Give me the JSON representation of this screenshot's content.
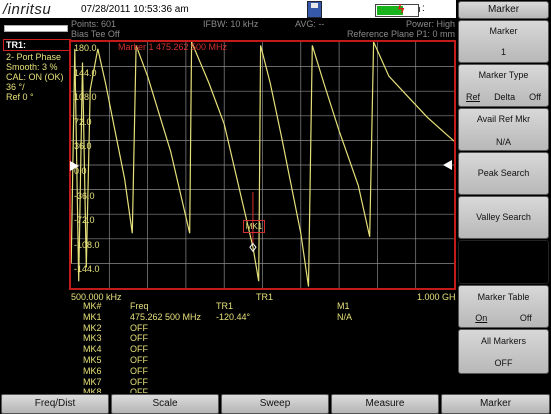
{
  "header": {
    "logo": "/inritsu",
    "datetime": "07/28/2011 10:53:36 am",
    "colon": ":"
  },
  "status": {
    "points": "Points: 601",
    "bias_tee": "Bias Tee Off",
    "ifbw": "IFBW: 10 kHz",
    "avg": "AVG: --",
    "power": "Power: High",
    "ref_plane": "Reference Plane P1: 0 mm",
    "battery_level": 0.65
  },
  "trace": {
    "name": "TR1:",
    "mode": "2- Port Phase",
    "smooth": "Smooth: 3 %",
    "cal": "CAL: ON (OK)",
    "scale": "36 °/",
    "ref": "Ref 0 °"
  },
  "plot": {
    "marker_readout": "Marker 1 475.262 500 MHz",
    "mk1_tag": "MK1",
    "y_ticks": [
      "180.0",
      "144.0",
      "108.0",
      "72.0",
      "36.0",
      "0.0",
      "-36.0",
      "-72.0",
      "-108.0",
      "-144.0"
    ],
    "x_start": "500.000 kHz",
    "x_trace": "TR1",
    "x_stop": "1.000 GHz",
    "trace_color": "#e6e07a",
    "grid_color": "#8a8a8a",
    "frame_color": "#c31a1a"
  },
  "chart_data": {
    "type": "line",
    "xlabel": "",
    "ylabel": "",
    "x_range": [
      "500.000 kHz",
      "1.000 GHz"
    ],
    "ylim": [
      -180,
      180
    ],
    "grid": true,
    "series": [
      {
        "name": "TR1",
        "x": [
          0.0005,
          0.01,
          0.02,
          0.03,
          0.04,
          0.05,
          0.07,
          0.09,
          0.115,
          0.14,
          0.16,
          0.17,
          0.2,
          0.26,
          0.31,
          0.315,
          0.36,
          0.4,
          0.45,
          0.475,
          0.49,
          0.495,
          0.52,
          0.55,
          0.6,
          0.62,
          0.63,
          0.66,
          0.7,
          0.75,
          0.78,
          0.79,
          0.83,
          0.88,
          0.93,
          0.98,
          1.0
        ],
        "y": [
          -144,
          170,
          -170,
          150,
          -150,
          110,
          170,
          120,
          50,
          -20,
          -100,
          175,
          130,
          20,
          -100,
          180,
          120,
          60,
          -60,
          -120,
          -170,
          175,
          120,
          40,
          -100,
          -178,
          175,
          120,
          50,
          -30,
          -105,
          180,
          130,
          100,
          70,
          45,
          35
        ]
      }
    ]
  },
  "markers_table": {
    "headers": [
      "MK#",
      "Freq",
      "TR1",
      "M1"
    ],
    "rows": [
      [
        "MK1",
        "475.262 500 MHz",
        "-120.44°",
        "N/A"
      ],
      [
        "MK2",
        "OFF",
        "",
        ""
      ],
      [
        "MK3",
        "OFF",
        "",
        ""
      ],
      [
        "MK4",
        "OFF",
        "",
        ""
      ],
      [
        "MK5",
        "OFF",
        "",
        ""
      ],
      [
        "MK6",
        "OFF",
        "",
        ""
      ],
      [
        "MK7",
        "OFF",
        "",
        ""
      ],
      [
        "MK8",
        "OFF",
        "",
        ""
      ]
    ]
  },
  "menu": {
    "title": "Marker",
    "marker_label": "Marker",
    "marker_value": "1",
    "marker_type_label": "Marker Type",
    "marker_type_ref": "Ref",
    "marker_type_delta": "Delta",
    "marker_type_off": "Off",
    "avail_ref_label": "Avail Ref Mkr",
    "avail_ref_value": "N/A",
    "peak_search": "Peak Search",
    "valley_search": "Valley Search",
    "marker_table_label": "Marker Table",
    "marker_table_on": "On",
    "marker_table_off": "Off",
    "all_markers_label": "All Markers",
    "all_markers_value": "OFF"
  },
  "bottom_bar": {
    "freq_dist": "Freq/Dist",
    "scale": "Scale",
    "sweep": "Sweep",
    "measure": "Measure",
    "marker": "Marker"
  }
}
